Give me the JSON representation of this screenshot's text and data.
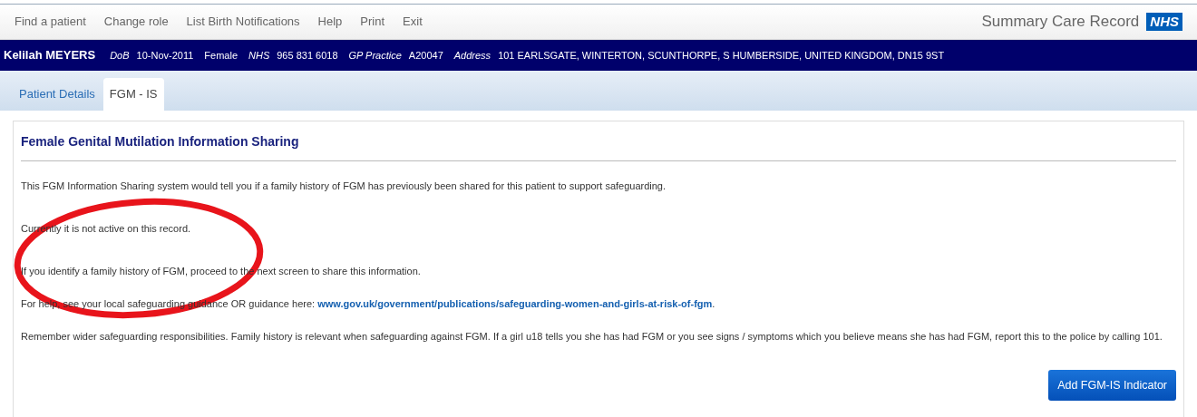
{
  "nav": {
    "items": [
      "Find a patient",
      "Change role",
      "List Birth Notifications",
      "Help",
      "Print",
      "Exit"
    ],
    "brand": "Summary Care Record",
    "logo": "NHS"
  },
  "patient": {
    "name": "Kelilah MEYERS",
    "fields": [
      {
        "label": "DoB",
        "value": "10-Nov-2011"
      },
      {
        "value": "Female"
      },
      {
        "label": "NHS",
        "value": "965 831 6018"
      },
      {
        "label": "GP Practice",
        "value": "A20047"
      },
      {
        "label": "Address",
        "value": "101 EARLSGATE, WINTERTON, SCUNTHORPE, S HUMBERSIDE, UNITED KINGDOM, DN15 9ST"
      }
    ]
  },
  "tabs": [
    {
      "label": "Patient Details",
      "selected": false
    },
    {
      "label": "FGM - IS",
      "selected": true
    }
  ],
  "panel": {
    "title": "Female Genital Mutilation Information Sharing",
    "paragraphs": [
      {
        "text": "This FGM Information Sharing system would tell you if a family history of FGM has previously been shared for this patient to support safeguarding.",
        "gap": false
      },
      {
        "text": "Currently it is not active on this record.",
        "gap": true
      },
      {
        "text": "If you identify a family history of FGM, proceed to the next screen to share this information.",
        "gap": true
      },
      {
        "text": "For help, see your local safeguarding guidance OR guidance here: ",
        "link": "www.gov.uk/government/publications/safeguarding-women-and-girls-at-risk-of-fgm",
        "after": ".",
        "gap": false
      },
      {
        "text": "Remember wider safeguarding responsibilities. Family history is relevant when safeguarding against FGM. If a girl u18 tells you she has had FGM or you see signs / symptoms which you believe means she has had FGM, report this to the police by calling 101."
      }
    ],
    "button": "Add FGM-IS Indicator"
  },
  "annotation": {
    "kind": "ellipse",
    "color": "#e8141b"
  }
}
